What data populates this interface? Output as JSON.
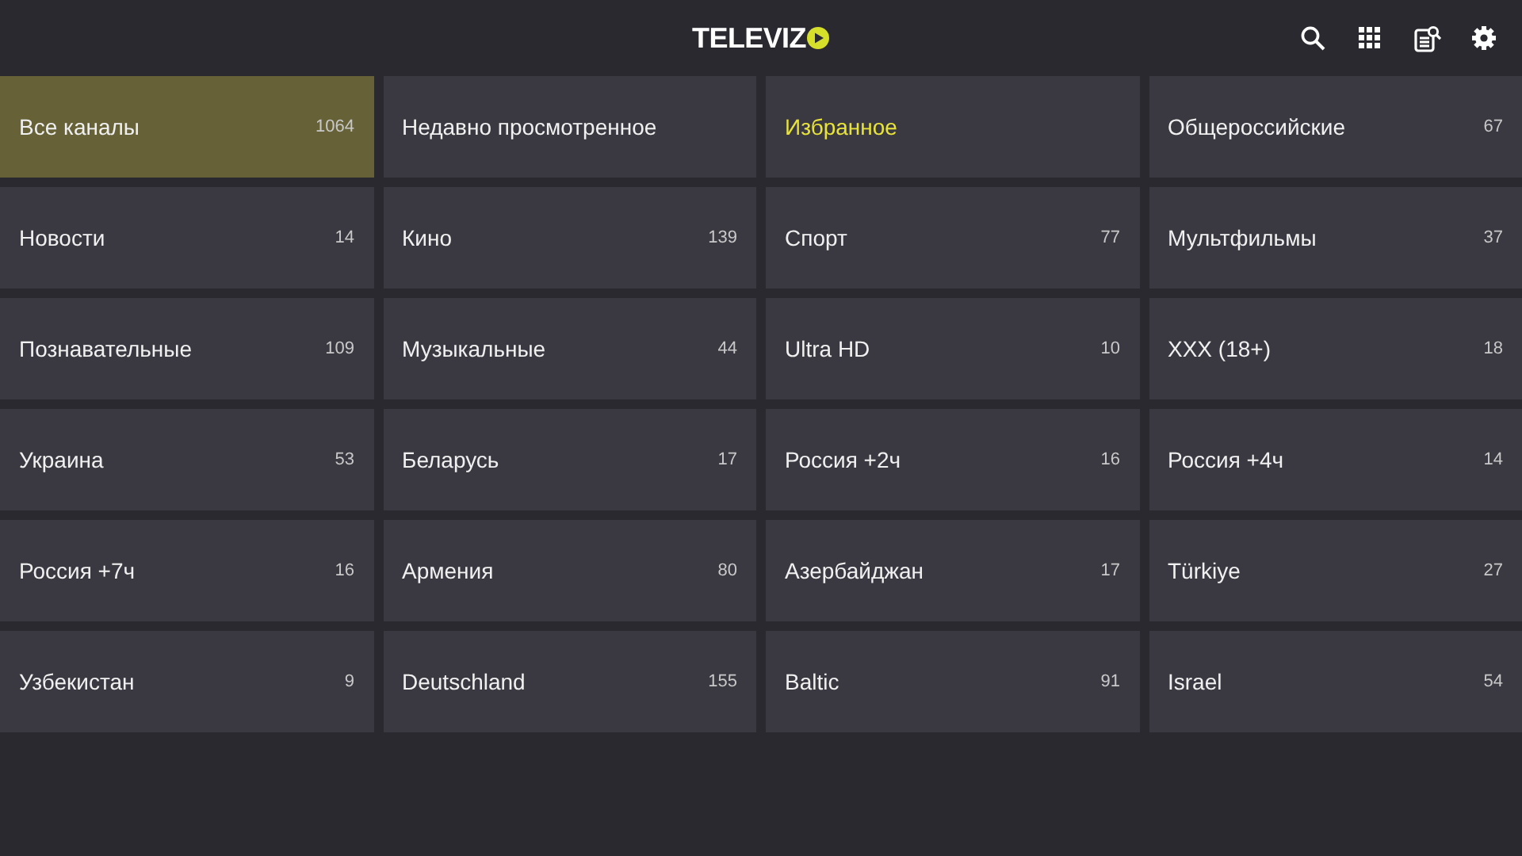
{
  "header": {
    "logo": "TELEVIZ"
  },
  "categories": [
    {
      "name": "Все каналы",
      "count": "1064",
      "selected": true,
      "accent": false
    },
    {
      "name": "Недавно просмотренное",
      "selected": false,
      "accent": false
    },
    {
      "name": "Избранное",
      "selected": false,
      "accent": true
    },
    {
      "name": "Общероссийские",
      "count": "67",
      "selected": false,
      "accent": false
    },
    {
      "name": "Новости",
      "count": "14",
      "selected": false,
      "accent": false
    },
    {
      "name": "Кино",
      "count": "139",
      "selected": false,
      "accent": false
    },
    {
      "name": "Спорт",
      "count": "77",
      "selected": false,
      "accent": false
    },
    {
      "name": "Мультфильмы",
      "count": "37",
      "selected": false,
      "accent": false
    },
    {
      "name": "Познавательные",
      "count": "109",
      "selected": false,
      "accent": false
    },
    {
      "name": "Музыкальные",
      "count": "44",
      "selected": false,
      "accent": false
    },
    {
      "name": "Ultra HD",
      "count": "10",
      "selected": false,
      "accent": false
    },
    {
      "name": "XXX (18+)",
      "count": "18",
      "selected": false,
      "accent": false
    },
    {
      "name": "Украина",
      "count": "53",
      "selected": false,
      "accent": false
    },
    {
      "name": "Беларусь",
      "count": "17",
      "selected": false,
      "accent": false
    },
    {
      "name": "Россия +2ч",
      "count": "16",
      "selected": false,
      "accent": false
    },
    {
      "name": "Россия +4ч",
      "count": "14",
      "selected": false,
      "accent": false
    },
    {
      "name": "Россия +7ч",
      "count": "16",
      "selected": false,
      "accent": false
    },
    {
      "name": "Армения",
      "count": "80",
      "selected": false,
      "accent": false
    },
    {
      "name": "Азербайджан",
      "count": "17",
      "selected": false,
      "accent": false
    },
    {
      "name": "Türkiye",
      "count": "27",
      "selected": false,
      "accent": false
    },
    {
      "name": "Узбекистан",
      "count": "9",
      "selected": false,
      "accent": false
    },
    {
      "name": "Deutschland",
      "count": "155",
      "selected": false,
      "accent": false
    },
    {
      "name": "Baltic",
      "count": "91",
      "selected": false,
      "accent": false
    },
    {
      "name": "Israel",
      "count": "54",
      "selected": false,
      "accent": false
    }
  ]
}
